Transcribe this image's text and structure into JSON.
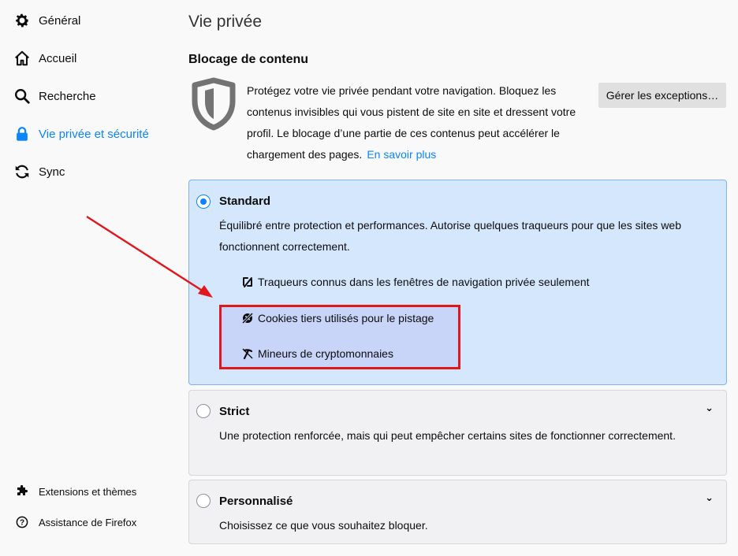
{
  "sidebar": {
    "items": [
      {
        "label": "Général",
        "icon": "gear-icon"
      },
      {
        "label": "Accueil",
        "icon": "home-icon"
      },
      {
        "label": "Recherche",
        "icon": "search-icon"
      },
      {
        "label": "Vie privée et sécurité",
        "icon": "lock-icon",
        "selected": true
      },
      {
        "label": "Sync",
        "icon": "sync-icon"
      }
    ],
    "footer": [
      {
        "label": "Extensions et thèmes",
        "icon": "puzzle-icon"
      },
      {
        "label": "Assistance de Firefox",
        "icon": "help-icon"
      }
    ]
  },
  "main": {
    "title": "Vie privée",
    "section_title": "Blocage de contenu",
    "description": "Protégez votre vie privée pendant votre navigation. Bloquez les contenus invisibles qui vous pistent de site en site et dressent votre profil. Le blocage d’une partie de ces contenus peut accélérer le chargement des pages.",
    "learn_more": "En savoir plus",
    "exceptions_button": "Gérer les exceptions…",
    "options": {
      "standard": {
        "label": "Standard",
        "description": "Équilibré entre protection et performances. Autorise quelques traqueurs pour que les sites web fonctionnent correctement.",
        "features": [
          "Traqueurs connus dans les fenêtres de navigation privée seulement",
          "Cookies tiers utilisés pour le pistage",
          "Mineurs de cryptomonnaies"
        ]
      },
      "strict": {
        "label": "Strict",
        "description": "Une protection renforcée, mais qui peut empêcher certains sites de fonctionner correctement."
      },
      "custom": {
        "label": "Personnalisé",
        "description": "Choisissez ce que vous souhaitez bloquer."
      }
    },
    "selected_option": "Standard"
  },
  "colors": {
    "accent": "#0a84ff",
    "selected_card_bg": "#d4e7fd",
    "annotation_red": "#e0171c",
    "highlight_fill": "#c8d5f8"
  }
}
